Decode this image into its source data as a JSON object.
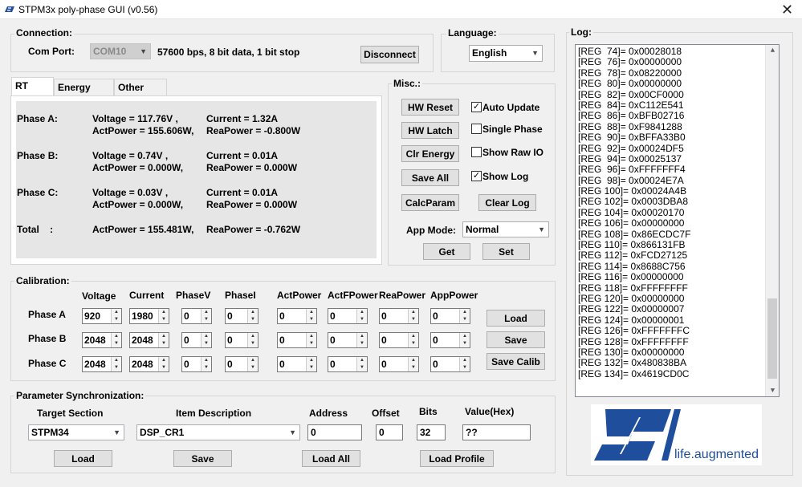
{
  "window": {
    "title": "STPM3x poly-phase GUI (v0.56)",
    "close": "✕"
  },
  "connection": {
    "group_label": "Connection:",
    "port_label": "Com Port:",
    "port_value": "COM10",
    "port_info": "57600 bps, 8 bit data, 1 bit stop",
    "disconnect": "Disconnect"
  },
  "language": {
    "group_label": "Language:",
    "value": "English"
  },
  "tabs": [
    "RT Info.",
    "Energy Info.",
    "Other Info."
  ],
  "rt": {
    "phases": [
      {
        "label": "Phase A:",
        "voltage": "Voltage = 117.76V ,",
        "current": "Current = 1.32A",
        "act": "ActPower = 155.606W,",
        "rea": "ReaPower = -0.800W"
      },
      {
        "label": "Phase B:",
        "voltage": "Voltage = 0.74V ,",
        "current": "Current = 0.01A",
        "act": "ActPower = 0.000W,",
        "rea": "ReaPower = 0.000W"
      },
      {
        "label": "Phase C:",
        "voltage": "Voltage = 0.03V ,",
        "current": "Current = 0.01A",
        "act": "ActPower = 0.000W,",
        "rea": "ReaPower = 0.000W"
      }
    ],
    "total": {
      "label": "Total    :",
      "act": "ActPower = 155.481W,",
      "rea": "ReaPower = -0.762W"
    }
  },
  "misc": {
    "group_label": "Misc.:",
    "buttons": {
      "hw_reset": "HW Reset",
      "hw_latch": "HW Latch",
      "clr_energy": "Clr Energy",
      "save_all": "Save All",
      "calc_param": "CalcParam",
      "clear_log": "Clear Log",
      "get": "Get",
      "set": "Set"
    },
    "checks": [
      {
        "label": "Auto Update",
        "checked": true
      },
      {
        "label": "Single Phase",
        "checked": false
      },
      {
        "label": "Show Raw IO",
        "checked": false
      },
      {
        "label": "Show Log",
        "checked": true
      }
    ],
    "app_mode_label": "App Mode:",
    "app_mode_value": "Normal"
  },
  "calibration": {
    "group_label": "Calibration:",
    "columns": [
      "Voltage",
      "Current",
      "PhaseV",
      "PhaseI",
      "ActPower",
      "ActFPower",
      "ReaPower",
      "AppPower"
    ],
    "rows": [
      {
        "label": "Phase A",
        "values": [
          "920",
          "1980",
          "0",
          "0",
          "0",
          "0",
          "0",
          "0"
        ]
      },
      {
        "label": "Phase B",
        "values": [
          "2048",
          "2048",
          "0",
          "0",
          "0",
          "0",
          "0",
          "0"
        ]
      },
      {
        "label": "Phase C",
        "values": [
          "2048",
          "2048",
          "0",
          "0",
          "0",
          "0",
          "0",
          "0"
        ]
      }
    ],
    "buttons": {
      "load": "Load",
      "save": "Save",
      "save_calib": "Save Calib"
    }
  },
  "param_sync": {
    "group_label": "Parameter Synchronization:",
    "target_label": "Target Section",
    "target_value": "STPM34",
    "item_label": "Item Description",
    "item_value": "DSP_CR1",
    "address_label": "Address",
    "address_value": "0",
    "offset_label": "Offset",
    "offset_value": "0",
    "bits_label": "Bits",
    "bits_value": "32",
    "value_label": "Value(Hex)",
    "value_value": "??",
    "buttons": {
      "load": "Load",
      "save": "Save",
      "load_all": "Load All",
      "load_profile": "Load Profile"
    }
  },
  "log": {
    "group_label": "Log:",
    "lines": [
      "[REG  74]= 0x00028018",
      "[REG  76]= 0x00000000",
      "[REG  78]= 0x08220000",
      "[REG  80]= 0x00000000",
      "[REG  82]= 0x00CF0000",
      "[REG  84]= 0xC112E541",
      "[REG  86]= 0xBFB02716",
      "[REG  88]= 0xF9841288",
      "[REG  90]= 0xBFFA33B0",
      "[REG  92]= 0x00024DF5",
      "[REG  94]= 0x00025137",
      "[REG  96]= 0xFFFFFFF4",
      "[REG  98]= 0x00024E7A",
      "[REG 100]= 0x00024A4B",
      "[REG 102]= 0x0003DBA8",
      "[REG 104]= 0x00020170",
      "[REG 106]= 0x00000000",
      "[REG 108]= 0x86ECDC7F",
      "[REG 110]= 0x866131FB",
      "[REG 112]= 0xFCD27125",
      "[REG 114]= 0x8688C756",
      "[REG 116]= 0x00000000",
      "[REG 118]= 0xFFFFFFFF",
      "[REG 120]= 0x00000000",
      "[REG 122]= 0x00000007",
      "[REG 124]= 0x00000001",
      "[REG 126]= 0xFFFFFFFC",
      "[REG 128]= 0xFFFFFFFF",
      "[REG 130]= 0x00000000",
      "[REG 132]= 0x480838BA",
      "[REG 134]= 0x4619CD0C"
    ]
  },
  "logo": {
    "tagline": "life.augmented",
    "brand_color": "#1f4e9c",
    "tagline_color": "#1f4e9c"
  }
}
